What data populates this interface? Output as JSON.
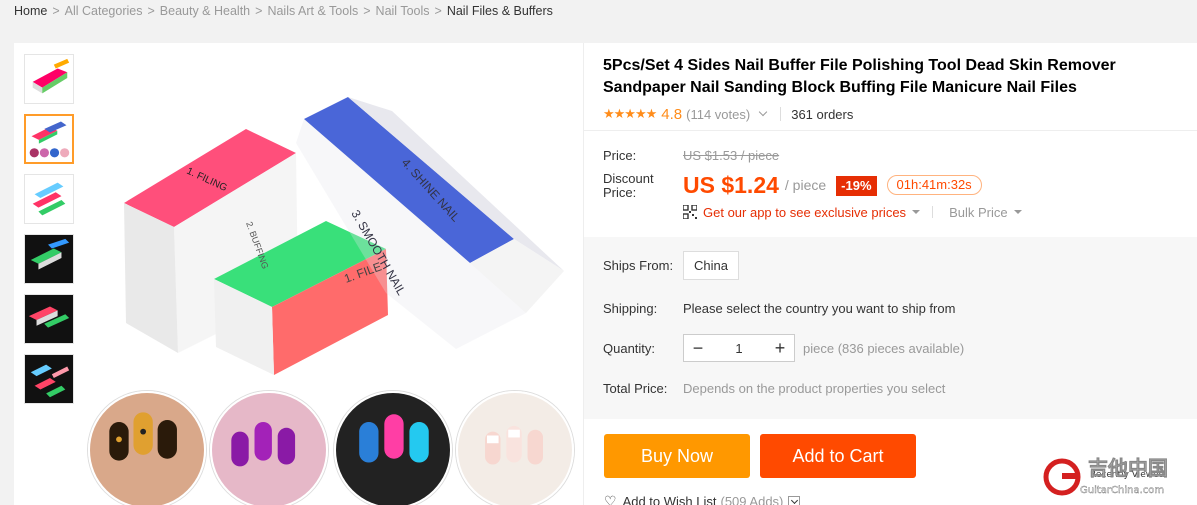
{
  "breadcrumb": [
    {
      "label": "Home"
    },
    {
      "label": "All Categories"
    },
    {
      "label": "Beauty & Health"
    },
    {
      "label": "Nails Art & Tools"
    },
    {
      "label": "Nail Tools"
    },
    {
      "label": "Nail Files & Buffers"
    }
  ],
  "product": {
    "title": "5Pcs/Set 4 Sides Nail Buffer File Polishing Tool Dead Skin Remover Sandpaper Nail Sanding Block Buffing File Manicure Nail Files",
    "stars": "★★★★★",
    "rating": "4.8",
    "votes": "(114 votes)",
    "orders": "361 orders",
    "image_text": {
      "side1": "1. FILING",
      "side2": "2. BUFFING",
      "side3": "3. SMOOTH NAIL",
      "side4": "4. SHINE NAIL",
      "side1b": "1. FILE"
    }
  },
  "price": {
    "price_label": "Price:",
    "old_price": "US $1.53 / piece",
    "discount_label_1": "Discount",
    "discount_label_2": "Price:",
    "new_price": "US $1.24",
    "per": "/ piece",
    "discount_badge": "-19%",
    "timer": "01h:41m:32s",
    "app_link": "Get our app to see exclusive prices",
    "bulk": "Bulk Price"
  },
  "sku": {
    "ships_from_label": "Ships From:",
    "ships_from_value": "China",
    "shipping_label": "Shipping:",
    "shipping_value": "Please select the country you want to ship from",
    "quantity_label": "Quantity:",
    "quantity_value": "1",
    "minus": "−",
    "plus": "+",
    "availability": "piece (836 pieces available)",
    "total_label": "Total Price:",
    "total_value": "Depends on the product properties you select"
  },
  "actions": {
    "buy_now": "Buy Now",
    "add_to_cart": "Add to Cart",
    "wishlist": "Add to Wish List",
    "wishlist_count": "(509 Adds)"
  },
  "watermark": {
    "text_cn": "吉他中国",
    "text_url": "GuitarChina.com",
    "partial": "Recently Viewed"
  },
  "colors": {
    "accent_orange": "#ff9800",
    "accent_red": "#ff4a00",
    "badge_red": "#e62e04",
    "star": "#ff8c1a"
  },
  "icons": [
    "qr-code-icon",
    "heart-icon",
    "chevron-down-icon",
    "caret-down-icon"
  ]
}
